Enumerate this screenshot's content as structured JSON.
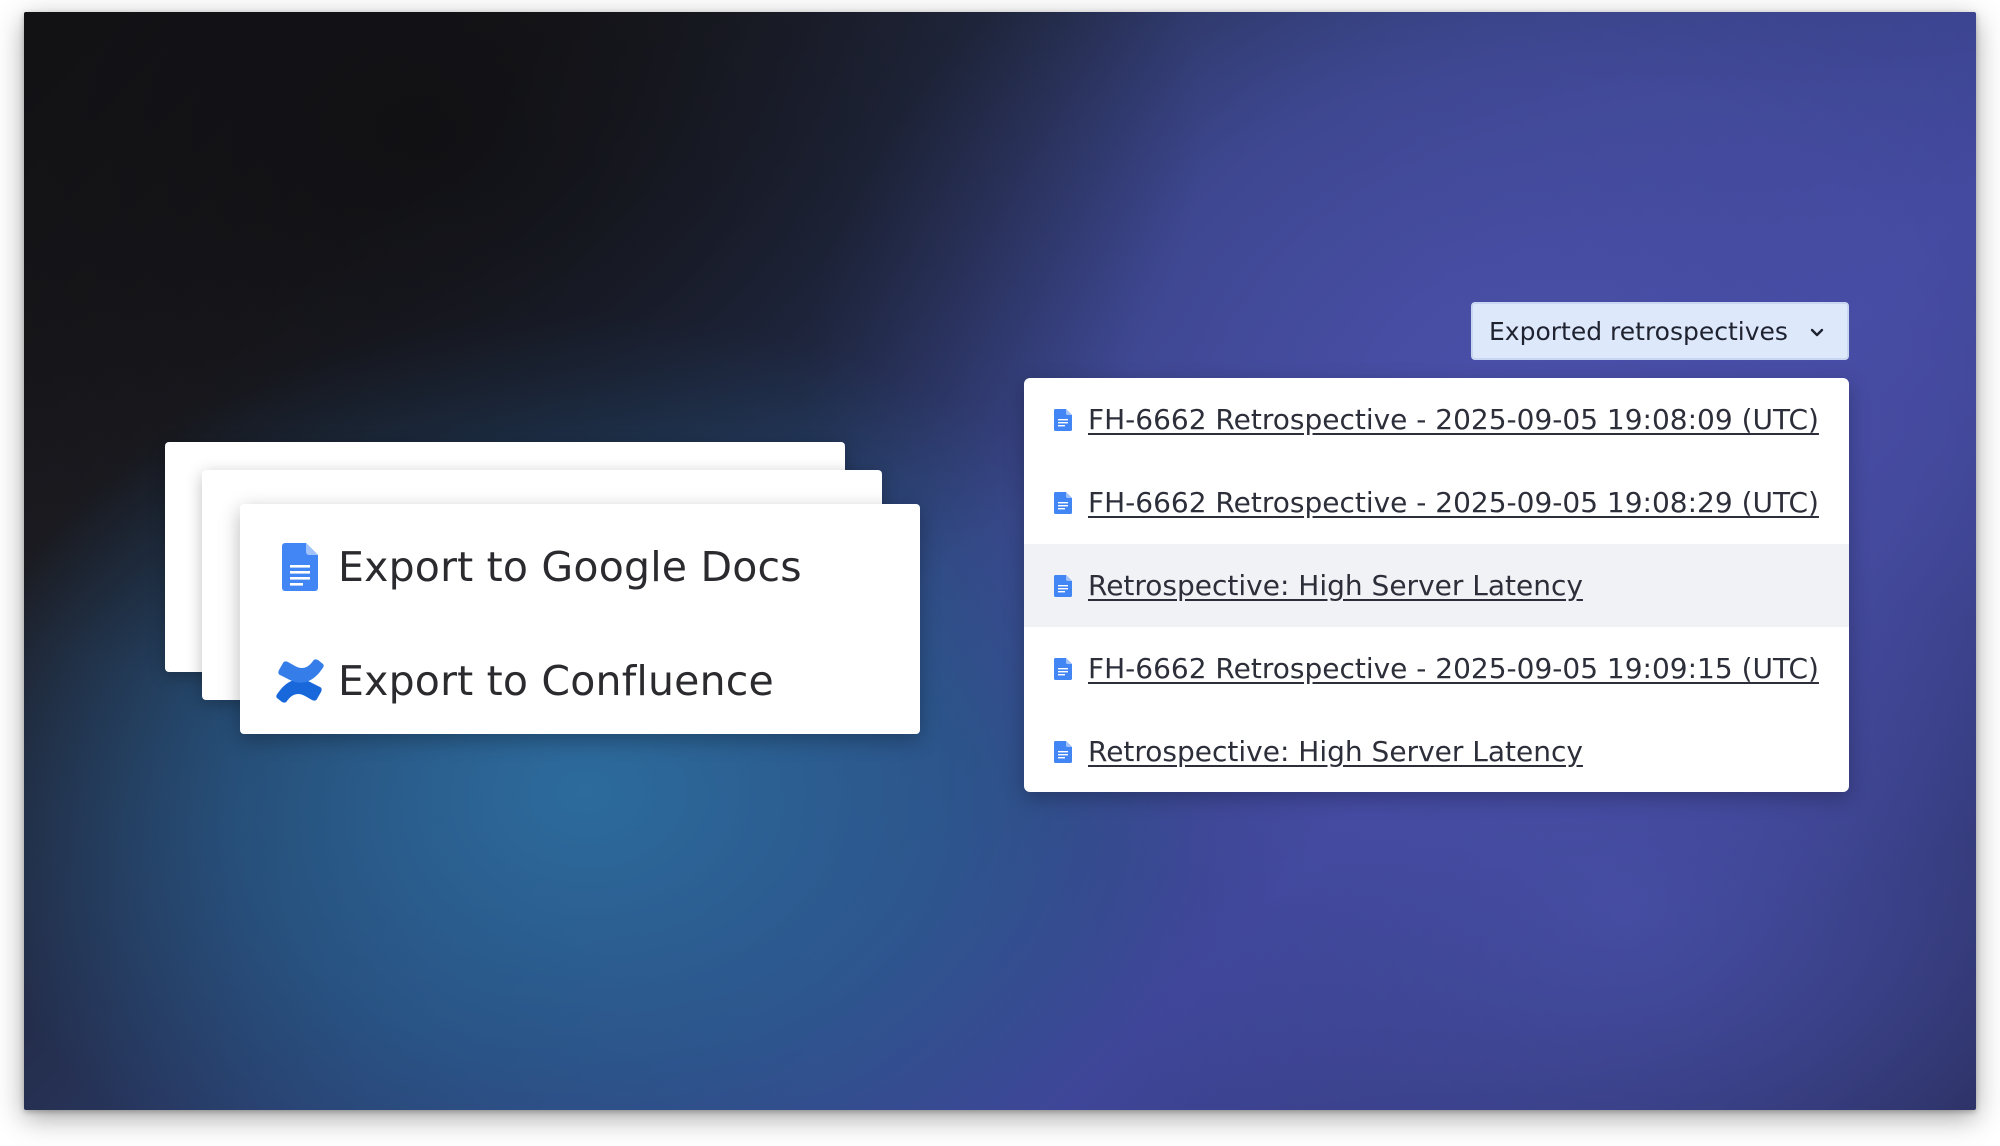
{
  "export_menu": {
    "google_docs_label": "Export to Google Docs",
    "confluence_label": "Export to Confluence",
    "google_icon": "google-docs-icon",
    "confluence_icon": "confluence-icon"
  },
  "retrospectives": {
    "dropdown_label": "Exported retrospectives",
    "chevron_icon": "chevron-down-icon",
    "items": [
      {
        "label": "FH-6662 Retrospective - 2025-09-05 19:08:09 (UTC)",
        "icon": "google-docs-icon"
      },
      {
        "label": "FH-6662 Retrospective - 2025-09-05 19:08:29 (UTC)",
        "icon": "google-docs-icon"
      },
      {
        "label": "Retrospective: High Server Latency",
        "icon": "google-docs-icon",
        "hovered": true
      },
      {
        "label": "FH-6662 Retrospective - 2025-09-05 19:09:15 (UTC)",
        "icon": "google-docs-icon"
      },
      {
        "label": "Retrospective: High Server Latency",
        "icon": "google-docs-icon"
      }
    ]
  },
  "colors": {
    "google_blue": "#4285F4",
    "confluence_blue": "#1868DB",
    "dropdown_bg": "#DDE8FB"
  }
}
